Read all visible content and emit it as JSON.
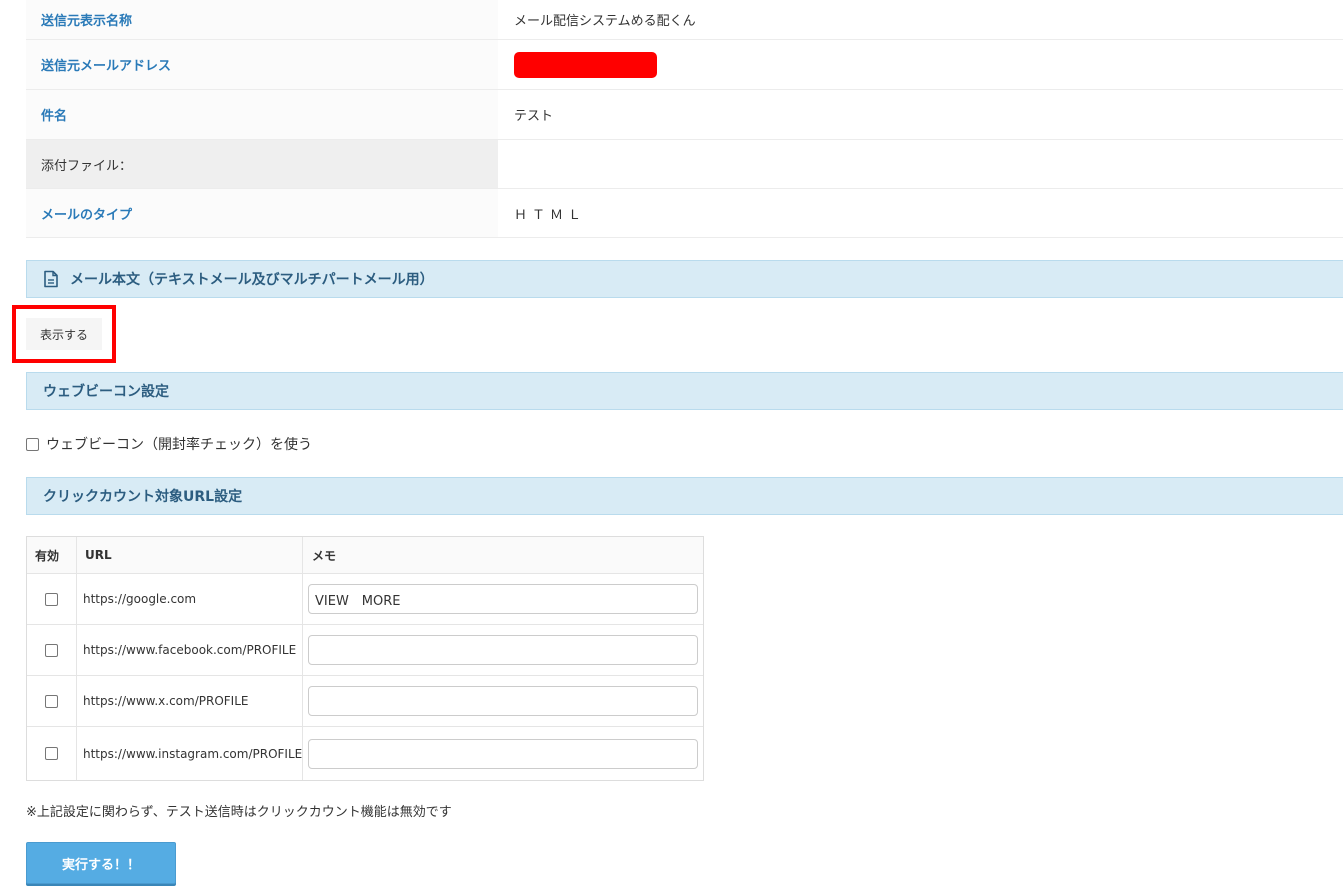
{
  "info": {
    "rows": [
      {
        "label": "送信元表示名称",
        "value": "メール配信システムめる配くん"
      },
      {
        "label": "送信元メールアドレス",
        "value": ""
      },
      {
        "label": "件名",
        "value": "テスト"
      },
      {
        "label": "添付ファイル：",
        "value": ""
      },
      {
        "label": "メールのタイプ",
        "value": "ＨＴＭＬ"
      }
    ],
    "redaction_color": "#ff0000"
  },
  "body_section": {
    "title": "メール本文（テキストメール及びマルチパートメール用）",
    "icon": "document-icon",
    "show_button": "表示する"
  },
  "beacon_section": {
    "title": "ウェブビーコン設定",
    "checkbox_label": "ウェブビーコン（開封率チェック）を使う",
    "checked": false
  },
  "click_section": {
    "title": "クリックカウント対象URL設定",
    "columns": [
      "有効",
      "URL",
      "メモ"
    ],
    "rows": [
      {
        "enabled": false,
        "url": "https://google.com",
        "memo": "VIEW　MORE"
      },
      {
        "enabled": false,
        "url": "https://www.facebook.com/PROFILE",
        "memo": ""
      },
      {
        "enabled": false,
        "url": "https://www.x.com/PROFILE",
        "memo": ""
      },
      {
        "enabled": false,
        "url": "https://www.instagram.com/PROFILE",
        "memo": ""
      }
    ]
  },
  "note": "※上記設定に関わらず、テスト送信時はクリックカウント機能は無効です",
  "execute_button": "実行する！！",
  "colors": {
    "accent": "#55ace3",
    "label_blue": "#2a7ab8",
    "section_bg": "#d8ebf5",
    "highlight": "#ff0000"
  }
}
